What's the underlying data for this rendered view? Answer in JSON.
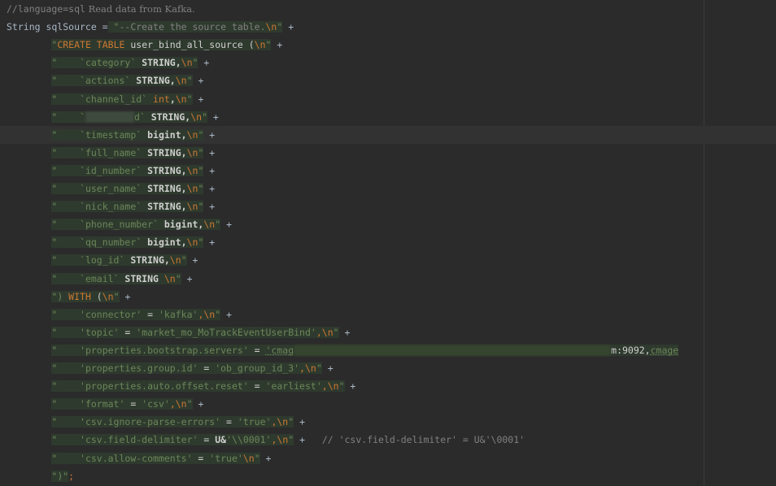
{
  "editor": {
    "lines": [
      {
        "parts": [
          {
            "t": "//language=sql",
            "c": "lc"
          },
          {
            "t": " Read data from Kafka.",
            "c": "comment"
          }
        ]
      },
      {
        "parts": [
          {
            "t": "String sqlSource =",
            "c": "plain"
          },
          {
            "t": " \"",
            "c": "str"
          },
          {
            "t": "--Create the source table.",
            "c": "sqlcom"
          },
          {
            "t": "\\n",
            "c": "esc"
          },
          {
            "t": "\"",
            "c": "str"
          },
          {
            "t": " +",
            "c": "plain"
          }
        ]
      },
      {
        "indent": "        ",
        "parts": [
          {
            "t": "\"",
            "c": "str"
          },
          {
            "t": "CREATE TABLE",
            "c": "sqlkw"
          },
          {
            "t": " user_bind_all_source (",
            "c": "sqlid"
          },
          {
            "t": "\\n",
            "c": "esc"
          },
          {
            "t": "\"",
            "c": "str"
          },
          {
            "t": " +",
            "c": "plain"
          }
        ]
      },
      {
        "indent": "        ",
        "parts": [
          {
            "t": "\"    ",
            "c": "str"
          },
          {
            "t": "`category`",
            "c": "sqlstr"
          },
          {
            "t": " STRING,",
            "c": "sqlty"
          },
          {
            "t": "\\n",
            "c": "esc"
          },
          {
            "t": "\"",
            "c": "str"
          },
          {
            "t": " +",
            "c": "plain"
          }
        ]
      },
      {
        "indent": "        ",
        "parts": [
          {
            "t": "\"    ",
            "c": "str"
          },
          {
            "t": "`actions`",
            "c": "sqlstr"
          },
          {
            "t": " STRING,",
            "c": "sqlty"
          },
          {
            "t": "\\n",
            "c": "esc"
          },
          {
            "t": "\"",
            "c": "str"
          },
          {
            "t": " +",
            "c": "plain"
          }
        ]
      },
      {
        "indent": "        ",
        "parts": [
          {
            "t": "\"    ",
            "c": "str"
          },
          {
            "t": "`channel_id`",
            "c": "sqlstr"
          },
          {
            "t": " int",
            "c": "sqlint"
          },
          {
            "t": ",",
            "c": "sqlty"
          },
          {
            "t": "\\n",
            "c": "esc"
          },
          {
            "t": "\"",
            "c": "str"
          },
          {
            "t": " +",
            "c": "plain"
          }
        ]
      },
      {
        "indent": "        ",
        "redact": true,
        "parts": [
          {
            "t": "\"    ",
            "c": "str"
          },
          {
            "t": "`",
            "c": "sqlstr"
          },
          {
            "t": "REDACT",
            "c": "redact"
          },
          {
            "t": "d`",
            "c": "sqlstr"
          },
          {
            "t": " STRING,",
            "c": "sqlty"
          },
          {
            "t": "\\n",
            "c": "esc"
          },
          {
            "t": "\"",
            "c": "str"
          },
          {
            "t": " +",
            "c": "plain"
          }
        ]
      },
      {
        "indent": "        ",
        "current": true,
        "parts": [
          {
            "t": "\"    ",
            "c": "str"
          },
          {
            "t": "`timestamp`",
            "c": "sqlstr"
          },
          {
            "t": " bigint,",
            "c": "sqlty"
          },
          {
            "t": "\\n",
            "c": "esc"
          },
          {
            "t": "\"",
            "c": "str"
          },
          {
            "t": " +",
            "c": "plain"
          }
        ]
      },
      {
        "indent": "        ",
        "parts": [
          {
            "t": "\"    ",
            "c": "str"
          },
          {
            "t": "`full_name`",
            "c": "sqlstr"
          },
          {
            "t": " STRING,",
            "c": "sqlty"
          },
          {
            "t": "\\n",
            "c": "esc"
          },
          {
            "t": "\"",
            "c": "str"
          },
          {
            "t": " +",
            "c": "plain"
          }
        ]
      },
      {
        "indent": "        ",
        "parts": [
          {
            "t": "\"    ",
            "c": "str"
          },
          {
            "t": "`id_number`",
            "c": "sqlstr"
          },
          {
            "t": " STRING,",
            "c": "sqlty"
          },
          {
            "t": "\\n",
            "c": "esc"
          },
          {
            "t": "\"",
            "c": "str"
          },
          {
            "t": " +",
            "c": "plain"
          }
        ]
      },
      {
        "indent": "        ",
        "parts": [
          {
            "t": "\"    ",
            "c": "str"
          },
          {
            "t": "`user_name`",
            "c": "sqlstr"
          },
          {
            "t": " STRING,",
            "c": "sqlty"
          },
          {
            "t": "\\n",
            "c": "esc"
          },
          {
            "t": "\"",
            "c": "str"
          },
          {
            "t": " +",
            "c": "plain"
          }
        ]
      },
      {
        "indent": "        ",
        "parts": [
          {
            "t": "\"    ",
            "c": "str"
          },
          {
            "t": "`nick_name`",
            "c": "sqlstr"
          },
          {
            "t": " STRING,",
            "c": "sqlty"
          },
          {
            "t": "\\n",
            "c": "esc"
          },
          {
            "t": "\"",
            "c": "str"
          },
          {
            "t": " +",
            "c": "plain"
          }
        ]
      },
      {
        "indent": "        ",
        "parts": [
          {
            "t": "\"    ",
            "c": "str"
          },
          {
            "t": "`phone_number`",
            "c": "sqlstr"
          },
          {
            "t": " bigint,",
            "c": "sqlty"
          },
          {
            "t": "\\n",
            "c": "esc"
          },
          {
            "t": "\"",
            "c": "str"
          },
          {
            "t": " +",
            "c": "plain"
          }
        ]
      },
      {
        "indent": "        ",
        "parts": [
          {
            "t": "\"    ",
            "c": "str"
          },
          {
            "t": "`qq_number`",
            "c": "sqlstr"
          },
          {
            "t": " bigint,",
            "c": "sqlty"
          },
          {
            "t": "\\n",
            "c": "esc"
          },
          {
            "t": "\"",
            "c": "str"
          },
          {
            "t": " +",
            "c": "plain"
          }
        ]
      },
      {
        "indent": "        ",
        "parts": [
          {
            "t": "\"    ",
            "c": "str"
          },
          {
            "t": "`log_id`",
            "c": "sqlstr"
          },
          {
            "t": " STRING,",
            "c": "sqlty"
          },
          {
            "t": "\\n",
            "c": "esc"
          },
          {
            "t": "\"",
            "c": "str"
          },
          {
            "t": " +",
            "c": "plain"
          }
        ]
      },
      {
        "indent": "        ",
        "parts": [
          {
            "t": "\"    ",
            "c": "str"
          },
          {
            "t": "`email`",
            "c": "sqlstr"
          },
          {
            "t": " STRING ",
            "c": "sqlty"
          },
          {
            "t": "\\n",
            "c": "esc"
          },
          {
            "t": "\"",
            "c": "str"
          },
          {
            "t": " +",
            "c": "plain"
          }
        ]
      },
      {
        "indent": "        ",
        "parts": [
          {
            "t": "\")",
            "c": "str"
          },
          {
            "t": " WITH",
            "c": "sqlkw"
          },
          {
            "t": " (",
            "c": "sqlid"
          },
          {
            "t": "\\n",
            "c": "esc"
          },
          {
            "t": "\"",
            "c": "str"
          },
          {
            "t": " +",
            "c": "plain"
          }
        ]
      },
      {
        "indent": "        ",
        "parts": [
          {
            "t": "\"    ",
            "c": "str"
          },
          {
            "t": "'connector'",
            "c": "sqlstr"
          },
          {
            "t": " = ",
            "c": "sqlid"
          },
          {
            "t": "'kafka'",
            "c": "sqlstr"
          },
          {
            "t": ",",
            "c": "sqlkw"
          },
          {
            "t": "\\n",
            "c": "esc"
          },
          {
            "t": "\"",
            "c": "str"
          },
          {
            "t": " +",
            "c": "plain"
          }
        ]
      },
      {
        "indent": "        ",
        "parts": [
          {
            "t": "\"    ",
            "c": "str"
          },
          {
            "t": "'topic'",
            "c": "sqlstr"
          },
          {
            "t": " = ",
            "c": "sqlid"
          },
          {
            "t": "'market_mo_MoTrackEventUserBind'",
            "c": "sqlstr"
          },
          {
            "t": ",",
            "c": "sqlkw"
          },
          {
            "t": "\\n",
            "c": "esc"
          },
          {
            "t": "\"",
            "c": "str"
          },
          {
            "t": " +",
            "c": "plain"
          }
        ]
      },
      {
        "indent": "        ",
        "long": true,
        "parts": [
          {
            "t": "\"    ",
            "c": "str"
          },
          {
            "t": "'properties.bootstrap.servers'",
            "c": "sqlstr"
          },
          {
            "t": " = ",
            "c": "sqlid"
          },
          {
            "t": "'cmag",
            "c": "sqlstr underline"
          },
          {
            "t": "REDACTLONG",
            "c": "redact-long"
          },
          {
            "t": "m:9092,",
            "c": "sqlid"
          },
          {
            "t": "cmage",
            "c": "sqlstr underline"
          }
        ]
      },
      {
        "indent": "        ",
        "parts": [
          {
            "t": "\"    ",
            "c": "str"
          },
          {
            "t": "'properties.group.id'",
            "c": "sqlstr"
          },
          {
            "t": " = ",
            "c": "sqlid"
          },
          {
            "t": "'ob_group_id_3'",
            "c": "sqlstr"
          },
          {
            "t": ",",
            "c": "sqlkw"
          },
          {
            "t": "\\n",
            "c": "esc"
          },
          {
            "t": "\"",
            "c": "str"
          },
          {
            "t": " +",
            "c": "plain"
          }
        ]
      },
      {
        "indent": "        ",
        "parts": [
          {
            "t": "\"    ",
            "c": "str"
          },
          {
            "t": "'properties.auto.offset.reset'",
            "c": "sqlstr"
          },
          {
            "t": " = ",
            "c": "sqlid"
          },
          {
            "t": "'earliest'",
            "c": "sqlstr"
          },
          {
            "t": ",",
            "c": "sqlkw"
          },
          {
            "t": "\\n",
            "c": "esc"
          },
          {
            "t": "\"",
            "c": "str"
          },
          {
            "t": " +",
            "c": "plain"
          }
        ]
      },
      {
        "indent": "        ",
        "parts": [
          {
            "t": "\"    ",
            "c": "str"
          },
          {
            "t": "'format'",
            "c": "sqlstr"
          },
          {
            "t": " = ",
            "c": "sqlid"
          },
          {
            "t": "'csv'",
            "c": "sqlstr"
          },
          {
            "t": ",",
            "c": "sqlkw"
          },
          {
            "t": "\\n",
            "c": "esc"
          },
          {
            "t": "\"",
            "c": "str"
          },
          {
            "t": " +",
            "c": "plain"
          }
        ]
      },
      {
        "indent": "        ",
        "parts": [
          {
            "t": "\"    ",
            "c": "str"
          },
          {
            "t": "'csv.ignore-parse-errors'",
            "c": "sqlstr"
          },
          {
            "t": " = ",
            "c": "sqlid"
          },
          {
            "t": "'true'",
            "c": "sqlstr"
          },
          {
            "t": ",",
            "c": "sqlkw"
          },
          {
            "t": "\\n",
            "c": "esc"
          },
          {
            "t": "\"",
            "c": "str"
          },
          {
            "t": " +",
            "c": "plain"
          }
        ]
      },
      {
        "indent": "        ",
        "parts": [
          {
            "t": "\"    ",
            "c": "str"
          },
          {
            "t": "'csv.field-delimiter'",
            "c": "sqlstr"
          },
          {
            "t": " = ",
            "c": "sqlid"
          },
          {
            "t": "U&",
            "c": "sqlty"
          },
          {
            "t": "'\\\\0001'",
            "c": "sqlstr"
          },
          {
            "t": ",",
            "c": "sqlkw"
          },
          {
            "t": "\\n",
            "c": "esc"
          },
          {
            "t": "\"",
            "c": "str"
          },
          {
            "t": " +",
            "c": "plain"
          },
          {
            "t": "   // 'csv.field-delimiter' = U&'\\0001'",
            "c": "lc"
          }
        ]
      },
      {
        "indent": "        ",
        "parts": [
          {
            "t": "\"    ",
            "c": "str"
          },
          {
            "t": "'csv.allow-comments'",
            "c": "sqlstr"
          },
          {
            "t": " = ",
            "c": "sqlid"
          },
          {
            "t": "'true'",
            "c": "sqlstr"
          },
          {
            "t": "\\n",
            "c": "esc"
          },
          {
            "t": "\"",
            "c": "str"
          },
          {
            "t": " +",
            "c": "plain"
          }
        ]
      },
      {
        "indent": "        ",
        "parts": [
          {
            "t": "\")\"",
            "c": "str"
          },
          {
            "t": ";",
            "c": "kw"
          }
        ]
      }
    ]
  }
}
